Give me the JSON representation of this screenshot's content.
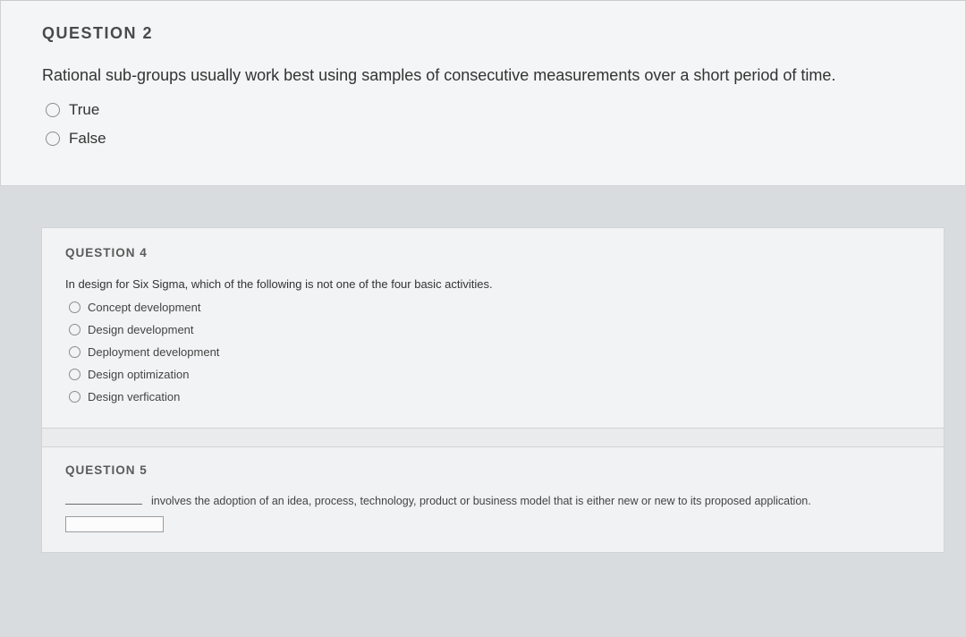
{
  "q2": {
    "header": "QUESTION 2",
    "prompt": "Rational sub-groups usually work best using samples of consecutive measurements over a short period of time.",
    "options": [
      "True",
      "False"
    ]
  },
  "q4": {
    "header": "QUESTION 4",
    "prompt": "In design for Six Sigma, which of the following is not one of the four basic activities.",
    "options": [
      "Concept development",
      "Design development",
      "Deployment development",
      "Design optimization",
      "Design verfication"
    ]
  },
  "q5": {
    "header": "QUESTION 5",
    "prompt_tail": "involves the adoption of an idea, process, technology, product or business model that is either new or new to its proposed application."
  }
}
